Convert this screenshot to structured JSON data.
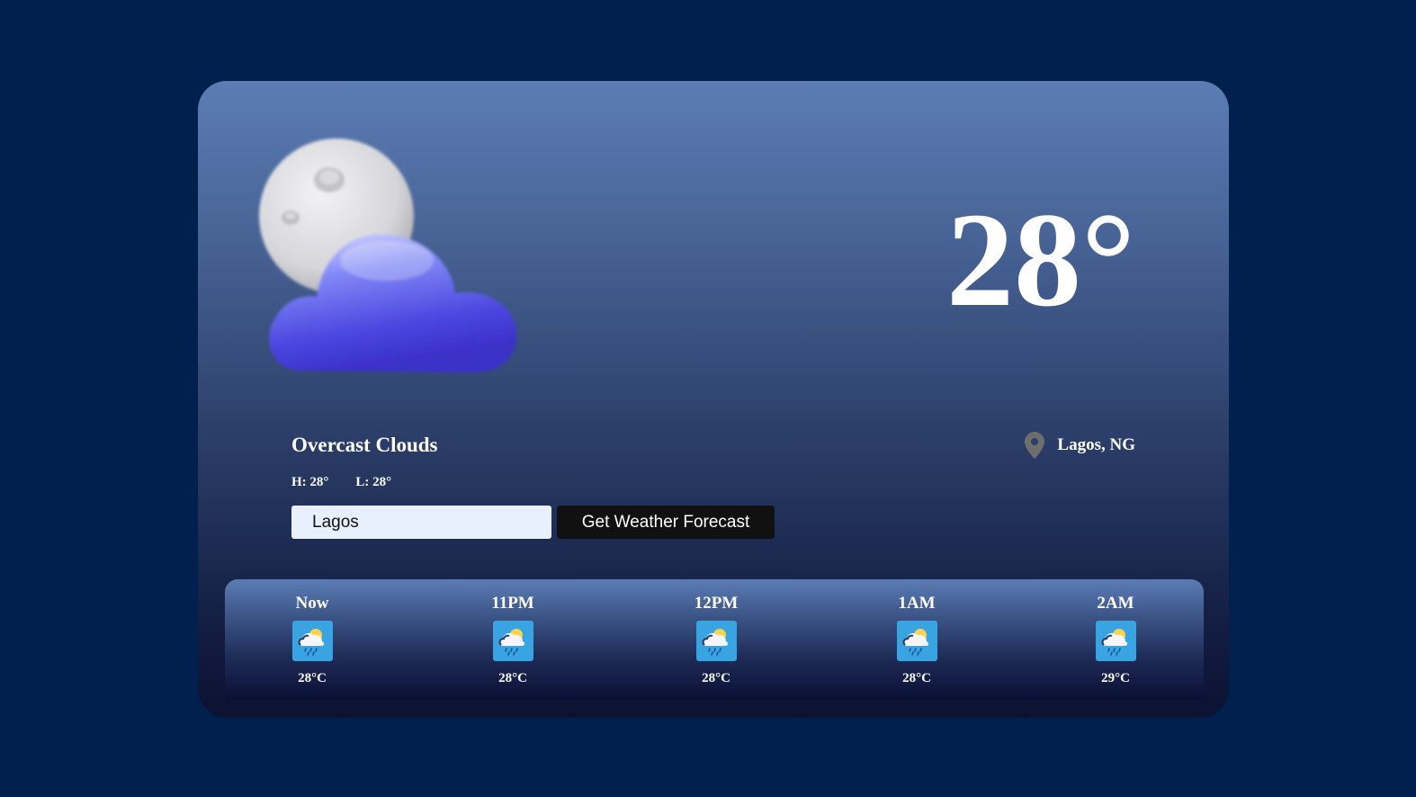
{
  "current": {
    "temperature": "28°",
    "condition": "Overcast Clouds",
    "high": "H: 28°",
    "low": "L: 28°",
    "icon": "moon-cloud-icon"
  },
  "location": {
    "name": "Lagos, NG",
    "icon": "location-pin-icon"
  },
  "search": {
    "value": "Lagos",
    "button_label": "Get Weather Forecast"
  },
  "hourly": [
    {
      "time": "Now",
      "temp": "28°C",
      "icon": "rain-sun-cloud-icon"
    },
    {
      "time": "11PM",
      "temp": "28°C",
      "icon": "rain-sun-cloud-icon"
    },
    {
      "time": "12PM",
      "temp": "28°C",
      "icon": "rain-sun-cloud-icon"
    },
    {
      "time": "1AM",
      "temp": "28°C",
      "icon": "rain-sun-cloud-icon"
    },
    {
      "time": "2AM",
      "temp": "29°C",
      "icon": "rain-sun-cloud-icon"
    }
  ],
  "colors": {
    "page_background": "#00204d",
    "card_top": "#5b7db4",
    "card_bottom": "#0b1232",
    "button_background": "#111111",
    "input_background": "#e8f0fe",
    "hour_icon_background": "#38a4e2"
  }
}
